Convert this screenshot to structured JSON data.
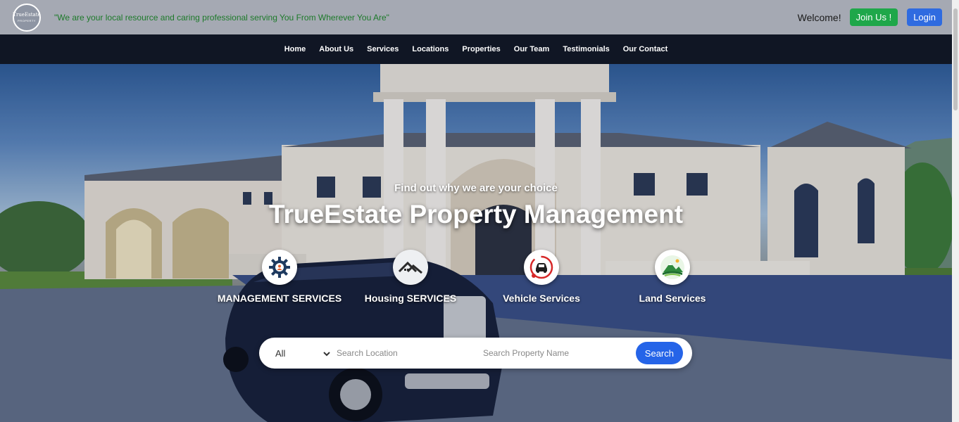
{
  "header": {
    "logo": {
      "brand": "TrueEstate",
      "subtitle": "PROPERTY"
    },
    "tagline": "\"We are your local resource and caring professional serving You From Wherever You Are\"",
    "welcome": "Welcome!",
    "join_label": "Join Us !",
    "login_label": "Login"
  },
  "nav": {
    "items": [
      {
        "label": "Home"
      },
      {
        "label": "About Us"
      },
      {
        "label": "Services"
      },
      {
        "label": "Locations"
      },
      {
        "label": "Properties"
      },
      {
        "label": "Our Team"
      },
      {
        "label": "Testimonials"
      },
      {
        "label": "Our Contact"
      }
    ]
  },
  "hero": {
    "subheading": "Find out why we are your choice",
    "heading": "TrueEstate Property Management",
    "services": [
      {
        "label": "MANAGEMENT SERVICES",
        "icon": "gear-person-icon"
      },
      {
        "label": "Housing SERVICES",
        "icon": "house-roof-icon"
      },
      {
        "label": "Vehicle Services",
        "icon": "car-wrench-icon"
      },
      {
        "label": "Land Services",
        "icon": "mountain-landscape-icon"
      }
    ]
  },
  "search": {
    "category_selected": "All",
    "location_placeholder": "Search Location",
    "property_placeholder": "Search Property Name",
    "button_label": "Search"
  },
  "colors": {
    "topbar_bg": "#a5a9b3",
    "nav_bg": "#101624",
    "tagline_text": "#1d7a2a",
    "join_button": "#1fa74a",
    "login_button": "#2f6be0",
    "search_button": "#2564e8"
  }
}
